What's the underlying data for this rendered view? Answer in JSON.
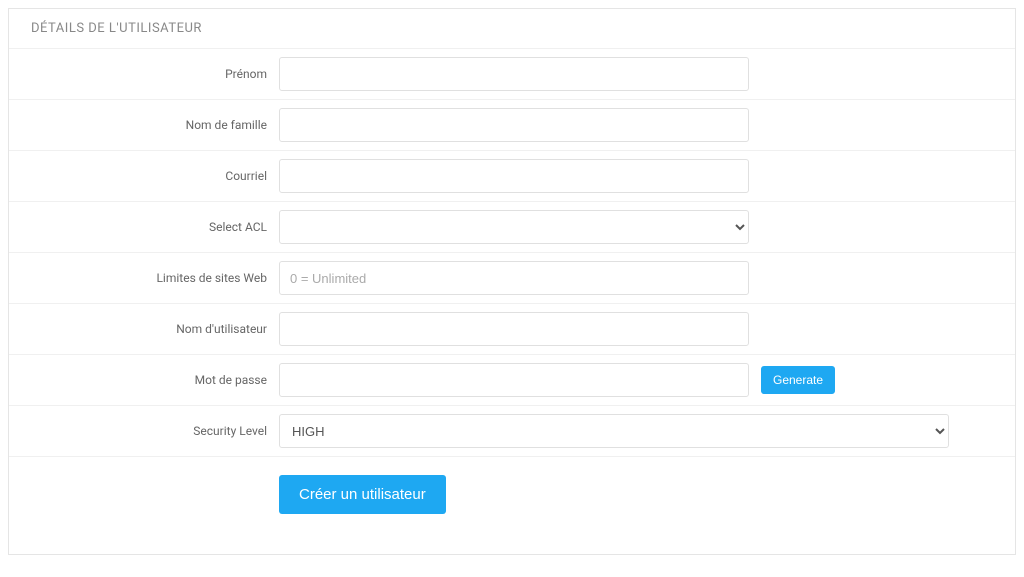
{
  "panel": {
    "title": "DÉTAILS DE L'UTILISATEUR"
  },
  "fields": {
    "firstname": {
      "label": "Prénom",
      "value": ""
    },
    "lastname": {
      "label": "Nom de famille",
      "value": ""
    },
    "email": {
      "label": "Courriel",
      "value": ""
    },
    "acl": {
      "label": "Select ACL",
      "value": ""
    },
    "weblimits": {
      "label": "Limites de sites Web",
      "placeholder": "0 = Unlimited",
      "value": ""
    },
    "username": {
      "label": "Nom d'utilisateur",
      "value": ""
    },
    "password": {
      "label": "Mot de passe",
      "value": ""
    },
    "security": {
      "label": "Security Level",
      "value": "HIGH",
      "options": [
        "HIGH"
      ]
    }
  },
  "buttons": {
    "generate": "Generate",
    "submit": "Créer un utilisateur"
  }
}
